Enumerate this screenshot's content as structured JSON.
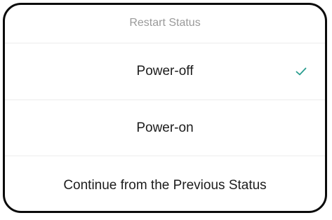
{
  "dialog": {
    "title": "Restart Status",
    "options": [
      {
        "label": "Power-off",
        "selected": true
      },
      {
        "label": "Power-on",
        "selected": false
      },
      {
        "label": "Continue from the Previous Status",
        "selected": false
      }
    ]
  },
  "colors": {
    "accent": "#2a9d8f",
    "title_text": "#9a9a9a",
    "option_text": "#1c1c1c",
    "divider": "#ececec",
    "frame": "#0a0a0a"
  },
  "icons": {
    "selected_indicator": "checkmark-icon"
  }
}
